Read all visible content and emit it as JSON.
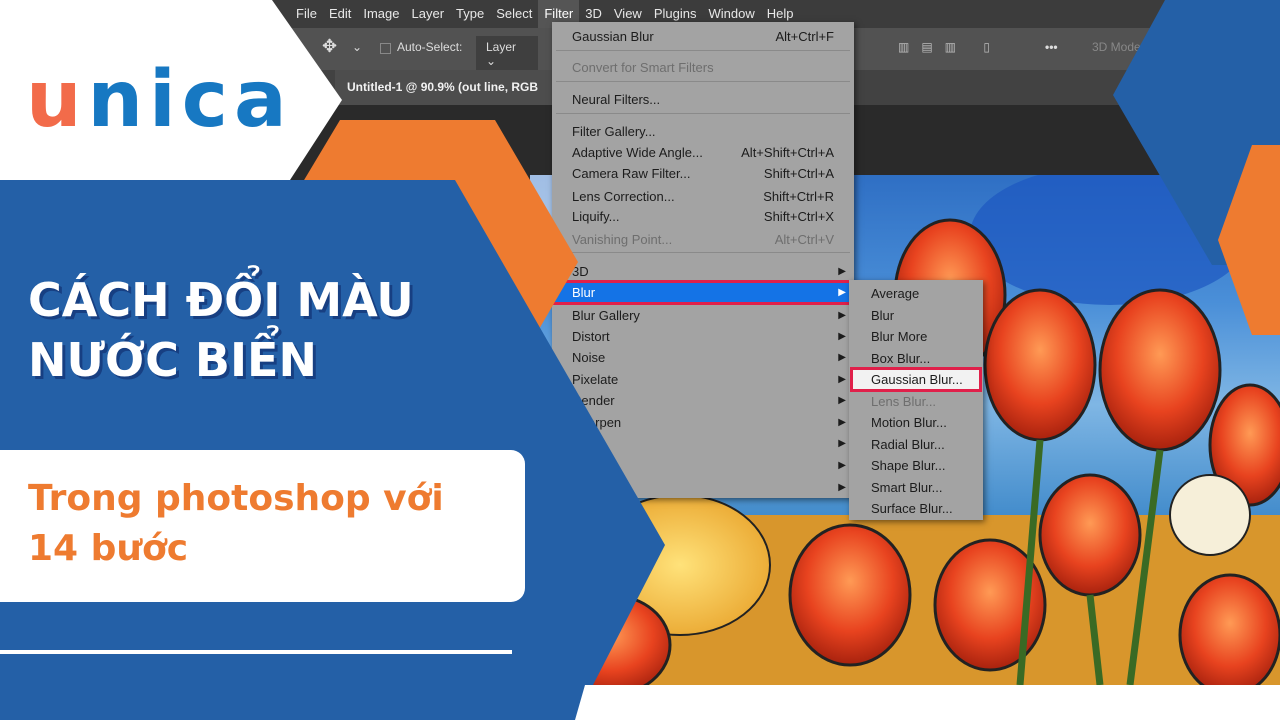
{
  "brand": {
    "logo_first": "u",
    "logo_rest": "nica",
    "accent_orange": "#ee7b30",
    "brand_blue": "#2460a7"
  },
  "headline": {
    "line1": "CÁCH ĐỔI MÀU",
    "line2": "NƯỚC BIỂN"
  },
  "subtitle": {
    "line1": "Trong photoshop với",
    "line2": "14 bước"
  },
  "photoshop": {
    "menubar": [
      "File",
      "Edit",
      "Image",
      "Layer",
      "Type",
      "Select",
      "Filter",
      "3D",
      "View",
      "Plugins",
      "Window",
      "Help"
    ],
    "active_menu": "Filter",
    "options": {
      "auto_select": "Auto-Select:",
      "layer_select": "Layer",
      "mode_3d": "3D Mode"
    },
    "doc_tab": "Untitled-1 @ 90.9% (out line, RGB",
    "filter_menu": [
      {
        "label": "Gaussian Blur",
        "shortcut": "Alt+Ctrl+F"
      },
      {
        "label": "Convert for Smart Filters",
        "disabled": true
      },
      {
        "label": "Neural Filters..."
      },
      {
        "label": "Filter Gallery..."
      },
      {
        "label": "Adaptive Wide Angle...",
        "shortcut": "Alt+Shift+Ctrl+A"
      },
      {
        "label": "Camera Raw Filter...",
        "shortcut": "Shift+Ctrl+A"
      },
      {
        "label": "Lens Correction...",
        "shortcut": "Shift+Ctrl+R"
      },
      {
        "label": "Liquify...",
        "shortcut": "Shift+Ctrl+X"
      },
      {
        "label": "Vanishing Point...",
        "shortcut": "Alt+Ctrl+V",
        "disabled": true
      },
      {
        "label": "3D"
      },
      {
        "label": "Blur",
        "highlighted": true
      },
      {
        "label": "Blur Gallery"
      },
      {
        "label": "Distort"
      },
      {
        "label": "Noise"
      },
      {
        "label": "Pixelate"
      },
      {
        "label": "Render"
      },
      {
        "label": "Sharpen"
      }
    ],
    "blur_submenu": [
      {
        "label": "Average"
      },
      {
        "label": "Blur"
      },
      {
        "label": "Blur More"
      },
      {
        "label": "Box Blur..."
      },
      {
        "label": "Gaussian Blur...",
        "selected": true
      },
      {
        "label": "Lens Blur...",
        "disabled": true
      },
      {
        "label": "Motion Blur..."
      },
      {
        "label": "Radial Blur..."
      },
      {
        "label": "Shape Blur..."
      },
      {
        "label": "Smart Blur..."
      },
      {
        "label": "Surface Blur..."
      }
    ]
  }
}
